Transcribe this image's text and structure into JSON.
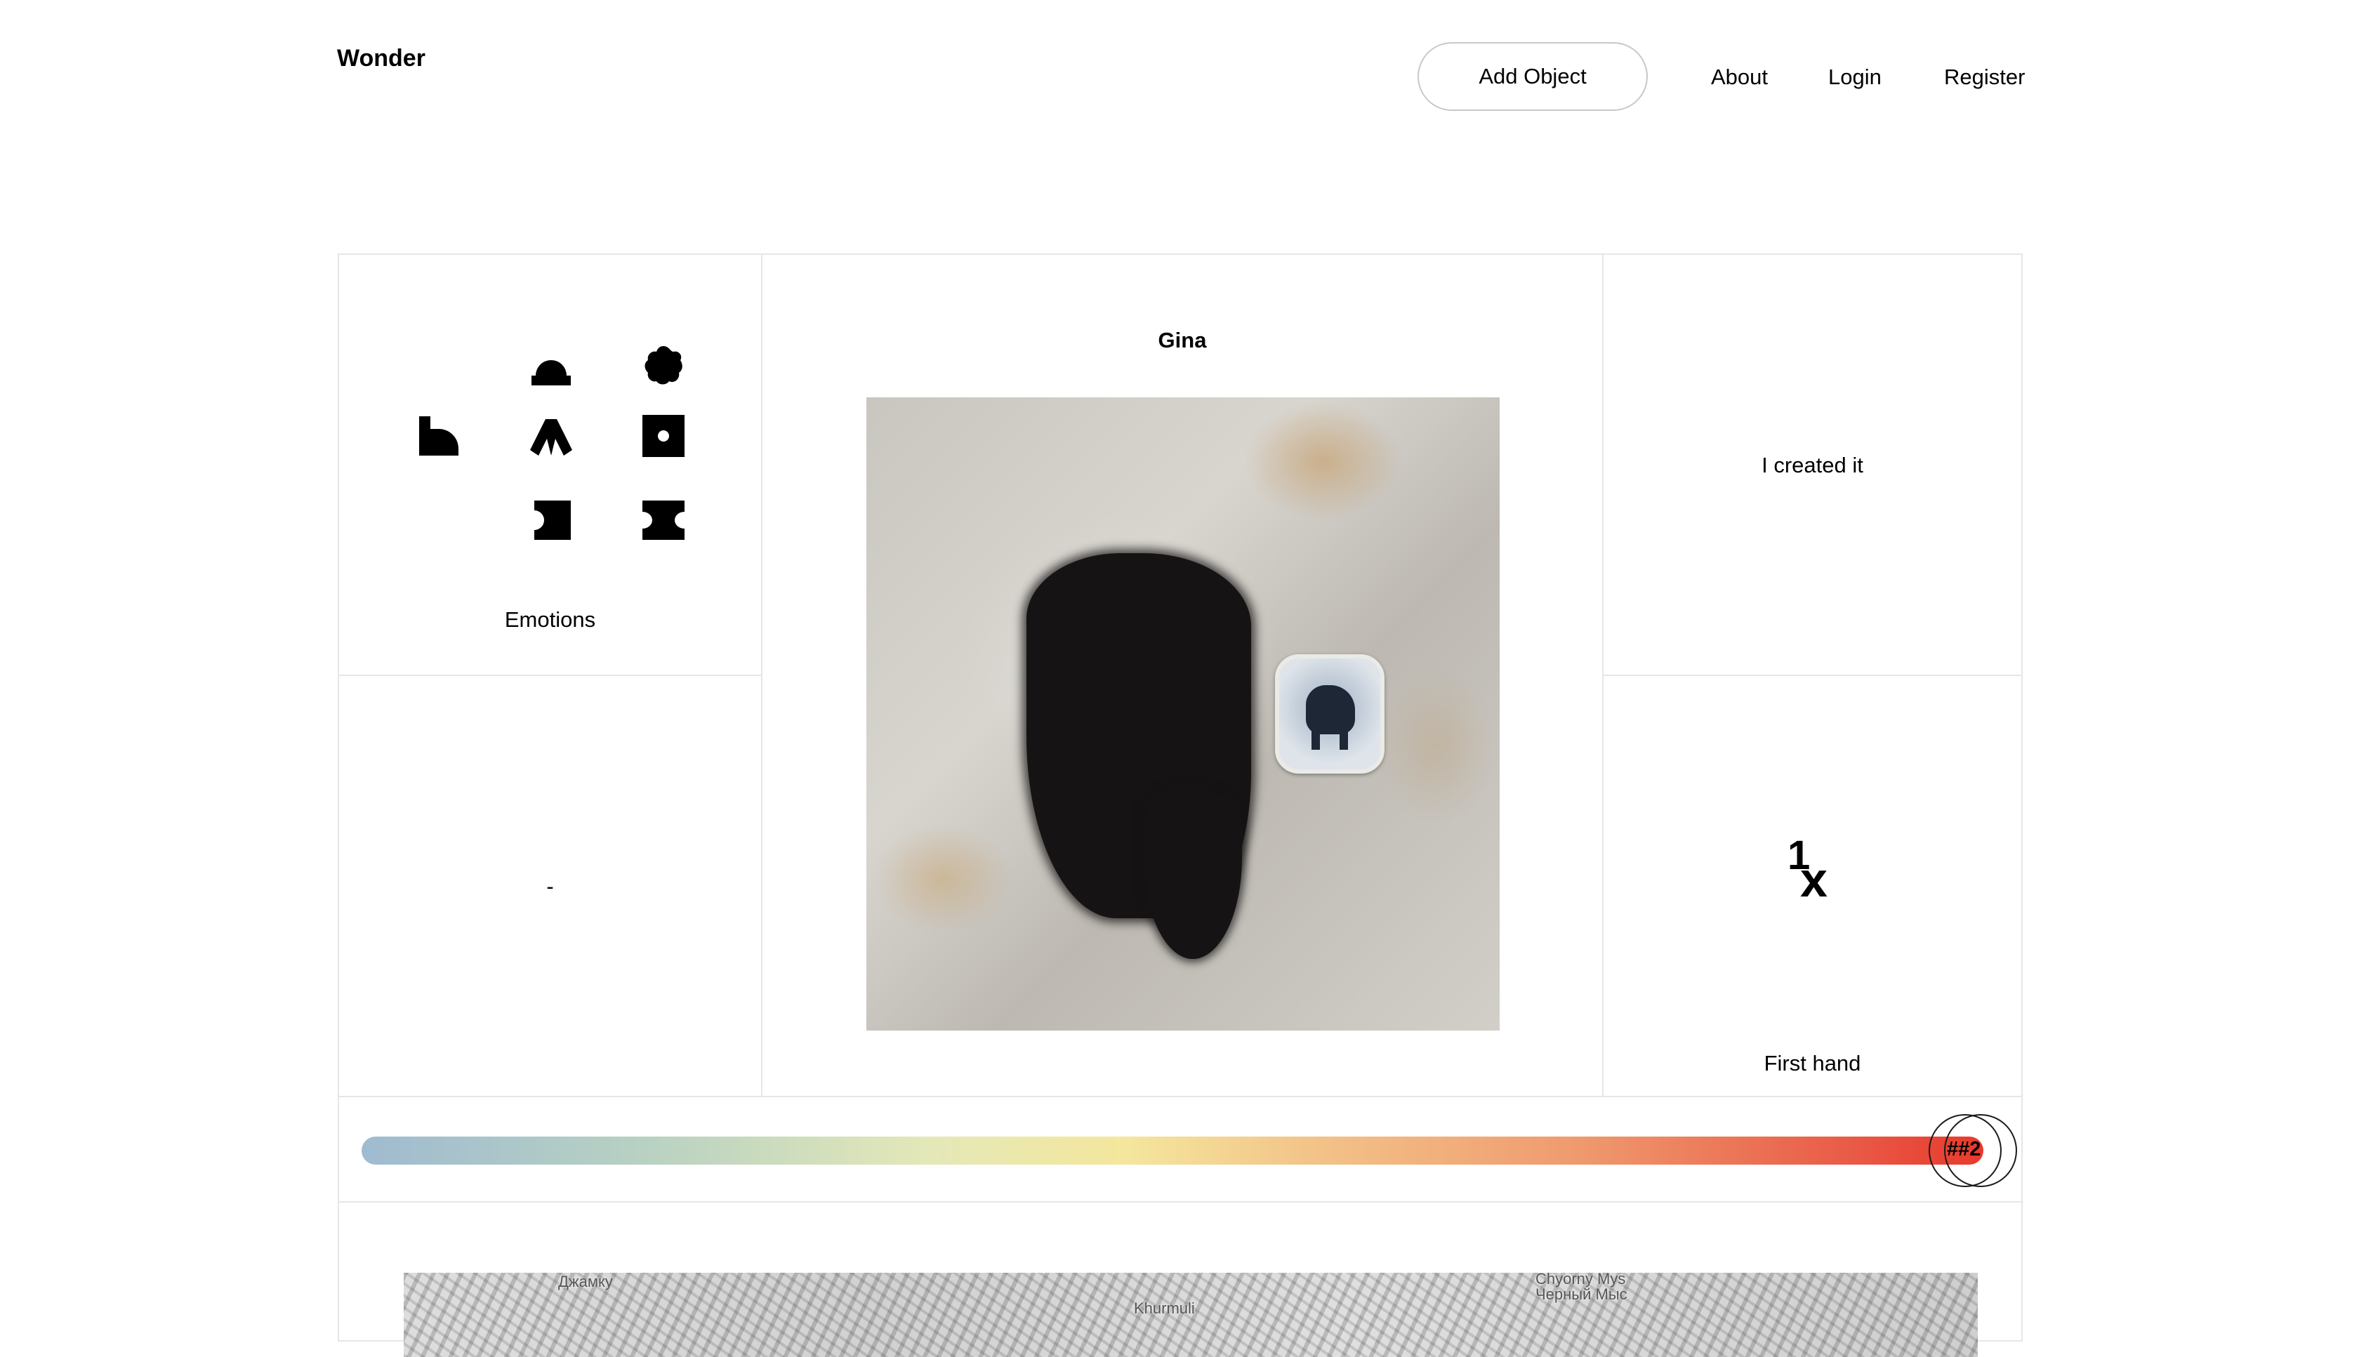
{
  "header": {
    "logo": "Wonder",
    "add_object_label": "Add Object",
    "nav": {
      "about": "About",
      "login": "Login",
      "register": "Register"
    }
  },
  "object": {
    "title": "Gina",
    "emotions_label": "Emotions",
    "placeholder_value": "-",
    "origin_text": "I created it",
    "count_value": "1",
    "count_suffix": "x",
    "provenance_label": "First hand",
    "slider_marker_label": "##2",
    "slider_position_fraction": 0.98
  },
  "map": {
    "labels": [
      "Джамку",
      "Khurmuli",
      "Chyorny Mys",
      "Черный Мыс"
    ]
  },
  "icons": {
    "emotion_glyphs": [
      "quarter-circle-step-icon",
      "dome-icon",
      "arch-icon",
      "puzzle-piece-icon",
      "flower-icon",
      "square-dot-icon",
      "hourglass-block-icon"
    ]
  }
}
